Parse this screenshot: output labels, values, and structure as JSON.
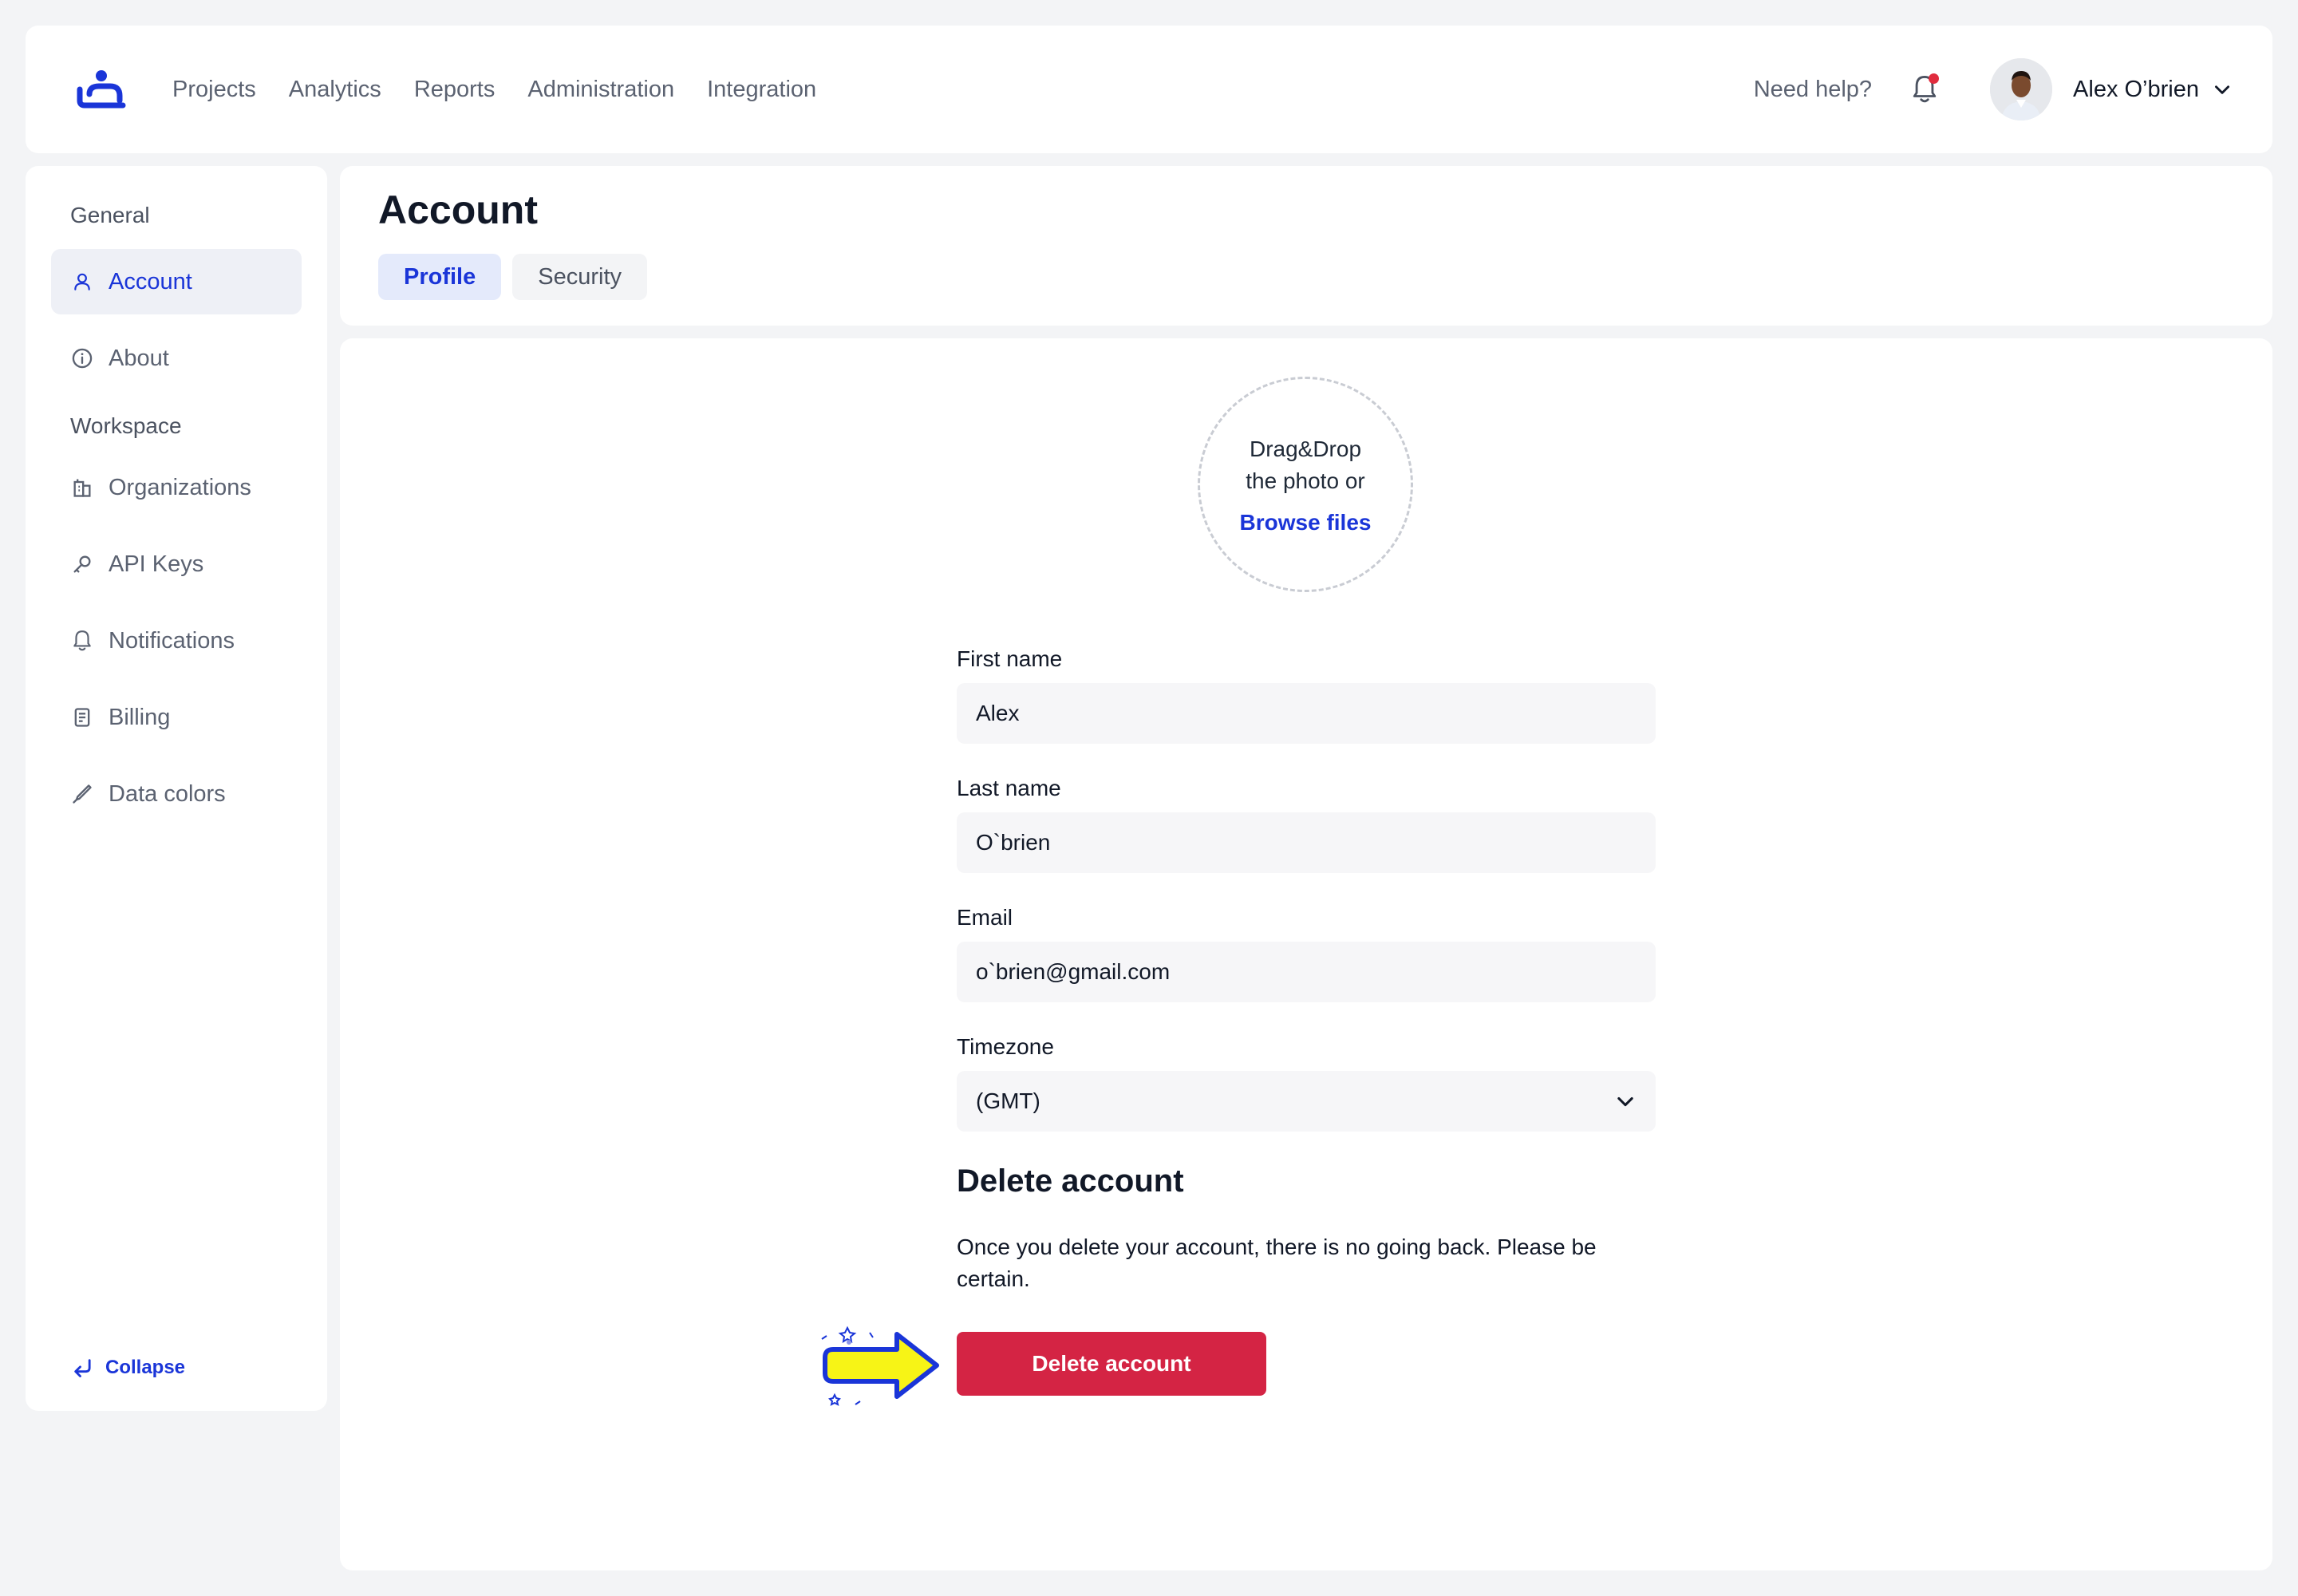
{
  "header": {
    "nav": [
      "Projects",
      "Analytics",
      "Reports",
      "Administration",
      "Integration"
    ],
    "help": "Need help?",
    "user_name": "Alex O’brien"
  },
  "sidebar": {
    "general_heading": "General",
    "workspace_heading": "Workspace",
    "general_items": [
      {
        "label": "Account",
        "icon": "user-icon",
        "active": true
      },
      {
        "label": "About",
        "icon": "info-icon"
      }
    ],
    "workspace_items": [
      {
        "label": "Organizations",
        "icon": "building-icon"
      },
      {
        "label": "API Keys",
        "icon": "key-icon"
      },
      {
        "label": "Notifications",
        "icon": "bell-icon"
      },
      {
        "label": "Billing",
        "icon": "document-icon"
      },
      {
        "label": "Data colors",
        "icon": "brush-icon"
      }
    ],
    "collapse": "Collapse"
  },
  "page": {
    "title": "Account",
    "tabs": [
      {
        "label": "Profile",
        "active": true
      },
      {
        "label": "Security"
      }
    ]
  },
  "upload": {
    "line1": "Drag&Drop",
    "line2": "the photo or",
    "browse": "Browse files"
  },
  "form": {
    "first_name_label": "First name",
    "first_name": "Alex",
    "last_name_label": "Last name",
    "last_name": "O`brien",
    "email_label": "Email",
    "email": "o`brien@gmail.com",
    "timezone_label": "Timezone",
    "timezone": "(GMT)"
  },
  "delete": {
    "title": "Delete account",
    "description": "Once you delete your account, there is no going back. Please be certain.",
    "button": "Delete account"
  },
  "colors": {
    "accent": "#1a35d8",
    "danger": "#d42444",
    "notification_dot": "#e02c3e",
    "highlight_arrow": "#f7f416"
  }
}
